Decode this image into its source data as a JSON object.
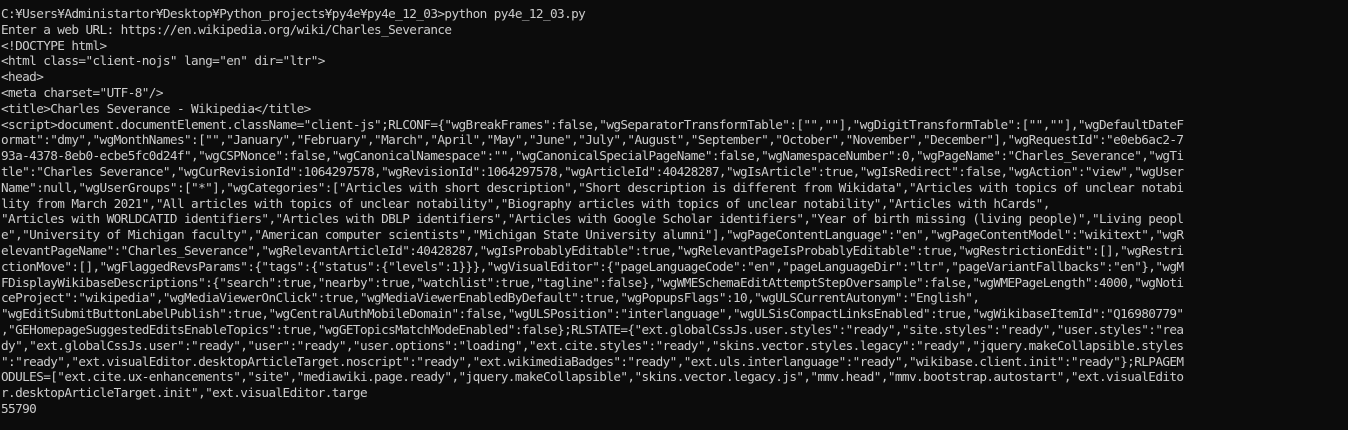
{
  "console": {
    "lines": [
      "C:¥Users¥Administartor¥Desktop¥Python_projects¥py4e¥py4e_12_03>python py4e_12_03.py",
      "Enter a web URL: https://en.wikipedia.org/wiki/Charles_Severance",
      "<!DOCTYPE html>",
      "<html class=\"client-nojs\" lang=\"en\" dir=\"ltr\">",
      "<head>",
      "<meta charset=\"UTF-8\"/>",
      "<title>Charles Severance - Wikipedia</title>",
      "<script>document.documentElement.className=\"client-js\";RLCONF={\"wgBreakFrames\":false,\"wgSeparatorTransformTable\":[\"\",\"\"],\"wgDigitTransformTable\":[\"\",\"\"],\"wgDefaultDateF",
      "ormat\":\"dmy\",\"wgMonthNames\":[\"\",\"January\",\"February\",\"March\",\"April\",\"May\",\"June\",\"July\",\"August\",\"September\",\"October\",\"November\",\"December\"],\"wgRequestId\":\"e0eb6ac2-7",
      "93a-4378-8eb0-ecbe5fc0d24f\",\"wgCSPNonce\":false,\"wgCanonicalNamespace\":\"\",\"wgCanonicalSpecialPageName\":false,\"wgNamespaceNumber\":0,\"wgPageName\":\"Charles_Severance\",\"wgTi",
      "tle\":\"Charles Severance\",\"wgCurRevisionId\":1064297578,\"wgRevisionId\":1064297578,\"wgArticleId\":40428287,\"wgIsArticle\":true,\"wgIsRedirect\":false,\"wgAction\":\"view\",\"wgUser",
      "Name\":null,\"wgUserGroups\":[\"*\"],\"wgCategories\":[\"Articles with short description\",\"Short description is different from Wikidata\",\"Articles with topics of unclear notabi",
      "lity from March 2021\",\"All articles with topics of unclear notability\",\"Biography articles with topics of unclear notability\",\"Articles with hCards\",",
      "\"Articles with WORLDCATID identifiers\",\"Articles with DBLP identifiers\",\"Articles with Google Scholar identifiers\",\"Year of birth missing (living people)\",\"Living peopl",
      "e\",\"University of Michigan faculty\",\"American computer scientists\",\"Michigan State University alumni\"],\"wgPageContentLanguage\":\"en\",\"wgPageContentModel\":\"wikitext\",\"wgR",
      "elevantPageName\":\"Charles_Severance\",\"wgRelevantArticleId\":40428287,\"wgIsProbablyEditable\":true,\"wgRelevantPageIsProbablyEditable\":true,\"wgRestrictionEdit\":[],\"wgRestri",
      "ctionMove\":[],\"wgFlaggedRevsParams\":{\"tags\":{\"status\":{\"levels\":1}}},\"wgVisualEditor\":{\"pageLanguageCode\":\"en\",\"pageLanguageDir\":\"ltr\",\"pageVariantFallbacks\":\"en\"},\"wgM",
      "FDisplayWikibaseDescriptions\":{\"search\":true,\"nearby\":true,\"watchlist\":true,\"tagline\":false},\"wgWMESchemaEditAttemptStepOversample\":false,\"wgWMEPageLength\":4000,\"wgNoti",
      "ceProject\":\"wikipedia\",\"wgMediaViewerOnClick\":true,\"wgMediaViewerEnabledByDefault\":true,\"wgPopupsFlags\":10,\"wgULSCurrentAutonym\":\"English\",",
      "\"wgEditSubmitButtonLabelPublish\":true,\"wgCentralAuthMobileDomain\":false,\"wgULSPosition\":\"interlanguage\",\"wgULSisCompactLinksEnabled\":true,\"wgWikibaseItemId\":\"Q16980779\"",
      ",\"GEHomepageSuggestedEditsEnableTopics\":true,\"wgGETopicsMatchModeEnabled\":false};RLSTATE={\"ext.globalCssJs.user.styles\":\"ready\",\"site.styles\":\"ready\",\"user.styles\":\"rea",
      "dy\",\"ext.globalCssJs.user\":\"ready\",\"user\":\"ready\",\"user.options\":\"loading\",\"ext.cite.styles\":\"ready\",\"skins.vector.styles.legacy\":\"ready\",\"jquery.makeCollapsible.styles",
      "\":\"ready\",\"ext.visualEditor.desktopArticleTarget.noscript\":\"ready\",\"ext.wikimediaBadges\":\"ready\",\"ext.uls.interlanguage\":\"ready\",\"wikibase.client.init\":\"ready\"};RLPAGEM",
      "ODULES=[\"ext.cite.ux-enhancements\",\"site\",\"mediawiki.page.ready\",\"jquery.makeCollapsible\",\"skins.vector.legacy.js\",\"mmv.head\",\"mmv.bootstrap.autostart\",\"ext.visualEdito",
      "r.desktopArticleTarget.init\",\"ext.visualEditor.targe",
      "55790"
    ]
  },
  "colors": {
    "background": "#0c0c0c",
    "text": "#cccccc"
  }
}
